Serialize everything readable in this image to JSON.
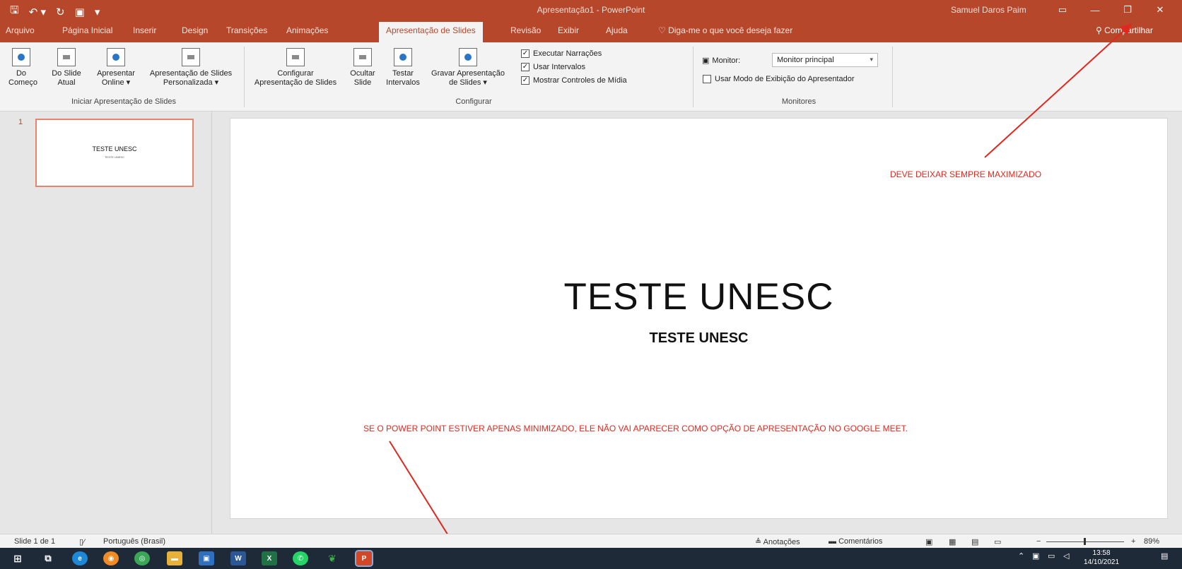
{
  "window": {
    "title": "Apresentação1 - PowerPoint",
    "user": "Samuel Daros Paim"
  },
  "colors": {
    "accent": "#b7472a",
    "annotation": "#e0281e",
    "taskbar": "#1f2a38"
  },
  "tabs": [
    "Arquivo",
    "Página Inicial",
    "Inserir",
    "Design",
    "Transições",
    "Animações",
    "Apresentação de Slides",
    "Revisão",
    "Exibir",
    "Ajuda"
  ],
  "active_tab": "Apresentação de Slides",
  "tellme": "Diga-me o que você deseja fazer",
  "share": "Compartilhar",
  "ribbon": {
    "start_group": {
      "label": "Iniciar Apresentação de Slides",
      "from_beginning": [
        "Do",
        "Começo"
      ],
      "from_current": [
        "Do Slide",
        "Atual"
      ],
      "present_online": [
        "Apresentar",
        "Online ▾"
      ],
      "custom_show": [
        "Apresentação de Slides",
        "Personalizada ▾"
      ]
    },
    "setup_group": {
      "label": "Configurar",
      "setup_show": [
        "Configurar",
        "Apresentação de Slides"
      ],
      "hide_slide": [
        "Ocultar",
        "Slide"
      ],
      "rehearse": [
        "Testar",
        "Intervalos"
      ],
      "record": [
        "Gravar Apresentação",
        "de Slides ▾"
      ],
      "checkboxes": [
        {
          "label": "Executar Narrações",
          "checked": true
        },
        {
          "label": "Usar Intervalos",
          "checked": true
        },
        {
          "label": "Mostrar Controles de Mídia",
          "checked": true
        }
      ]
    },
    "monitors_group": {
      "label": "Monitores",
      "monitor_label": "Monitor:",
      "monitor_value": "Monitor principal",
      "presenter_view": {
        "label": "Usar Modo de Exibição do Apresentador",
        "checked": false
      }
    }
  },
  "thumbnails": [
    {
      "number": "1",
      "title": "TESTE UNESC",
      "subtitle": "TESTE UNESC"
    }
  ],
  "slide": {
    "title": "TESTE UNESC",
    "subtitle": "TESTE UNESC"
  },
  "annotations": {
    "maximize_note": "DEVE DEIXAR SEMPRE MAXIMIZADO",
    "minimize_note": "SE O POWER POINT ESTIVER APENAS MINIMIZADO, ELE NÃO VAI APARECER COMO OPÇÃO DE APRESENTAÇÃO NO GOOGLE MEET."
  },
  "statusbar": {
    "slide_info": "Slide 1 de 1",
    "language": "Português (Brasil)",
    "notes": "Anotações",
    "comments": "Comentários",
    "zoom": "89%"
  },
  "taskbar": {
    "time": "13:58",
    "date": "14/10/2021"
  }
}
